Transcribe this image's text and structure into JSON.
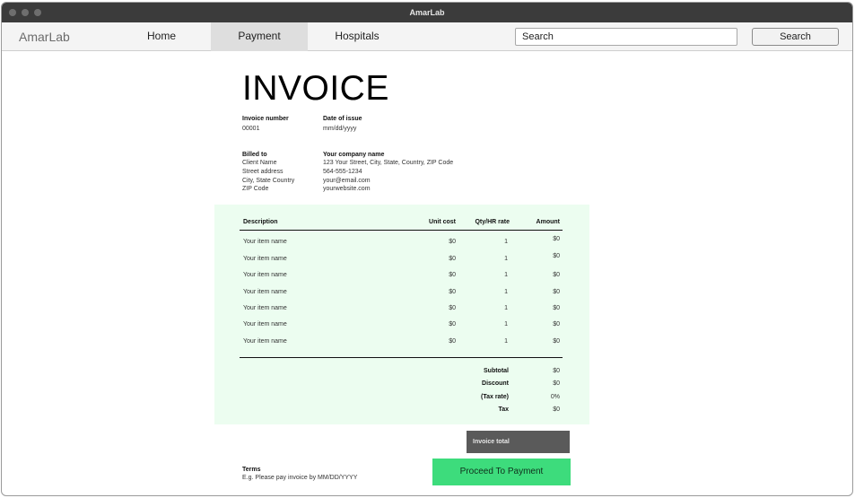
{
  "window": {
    "title": "AmarLab"
  },
  "nav": {
    "brand": "AmarLab",
    "items": [
      {
        "label": "Home",
        "active": false
      },
      {
        "label": "Payment",
        "active": true
      },
      {
        "label": "Hospitals",
        "active": false
      }
    ],
    "search": {
      "value": "Search",
      "button_label": "Search"
    }
  },
  "invoice": {
    "title": "INVOICE",
    "invoice_number_label": "Invoice number",
    "invoice_number": "00001",
    "date_label": "Date of issue",
    "date": "mm/dd/yyyy",
    "billed_to_label": "Billed to",
    "billed_to": [
      "Client Name",
      "Street address",
      "City, State Country",
      "ZIP Code"
    ],
    "company_label": "Your company name",
    "company": [
      "123 Your Street, City, State, Country, ZIP Code",
      "564-555-1234",
      "your@email.com",
      "yourwebsite.com"
    ],
    "table": {
      "headers": {
        "description": "Description",
        "unit_cost": "Unit cost",
        "qty": "Qty/HR rate",
        "amount": "Amount"
      },
      "rows": [
        {
          "description": "Your item name",
          "unit_cost": "$0",
          "qty": "1",
          "amount": "$0"
        },
        {
          "description": "Your item name",
          "unit_cost": "$0",
          "qty": "1",
          "amount": "$0"
        },
        {
          "description": "Your item name",
          "unit_cost": "$0",
          "qty": "1",
          "amount": "$0"
        },
        {
          "description": "Your item name",
          "unit_cost": "$0",
          "qty": "1",
          "amount": "$0"
        },
        {
          "description": "Your item name",
          "unit_cost": "$0",
          "qty": "1",
          "amount": "$0"
        },
        {
          "description": "Your item name",
          "unit_cost": "$0",
          "qty": "1",
          "amount": "$0"
        },
        {
          "description": "Your item name",
          "unit_cost": "$0",
          "qty": "1",
          "amount": "$0"
        }
      ]
    },
    "summary": [
      {
        "label": "Subtotal",
        "value": "$0"
      },
      {
        "label": "Discount",
        "value": "$0"
      },
      {
        "label": "(Tax rate)",
        "value": "0%"
      },
      {
        "label": "Tax",
        "value": "$0"
      }
    ],
    "invoice_total_label": "Invoice total",
    "terms_label": "Terms",
    "terms_text": "E.g. Please pay invoice by MM/DD/YYYY",
    "proceed_label": "Proceed To Payment"
  },
  "colors": {
    "titlebar": "#3b3b3b",
    "table_background": "#ecfdf0",
    "total_box": "#5a5a5a",
    "proceed_button": "#3ddc7c"
  }
}
